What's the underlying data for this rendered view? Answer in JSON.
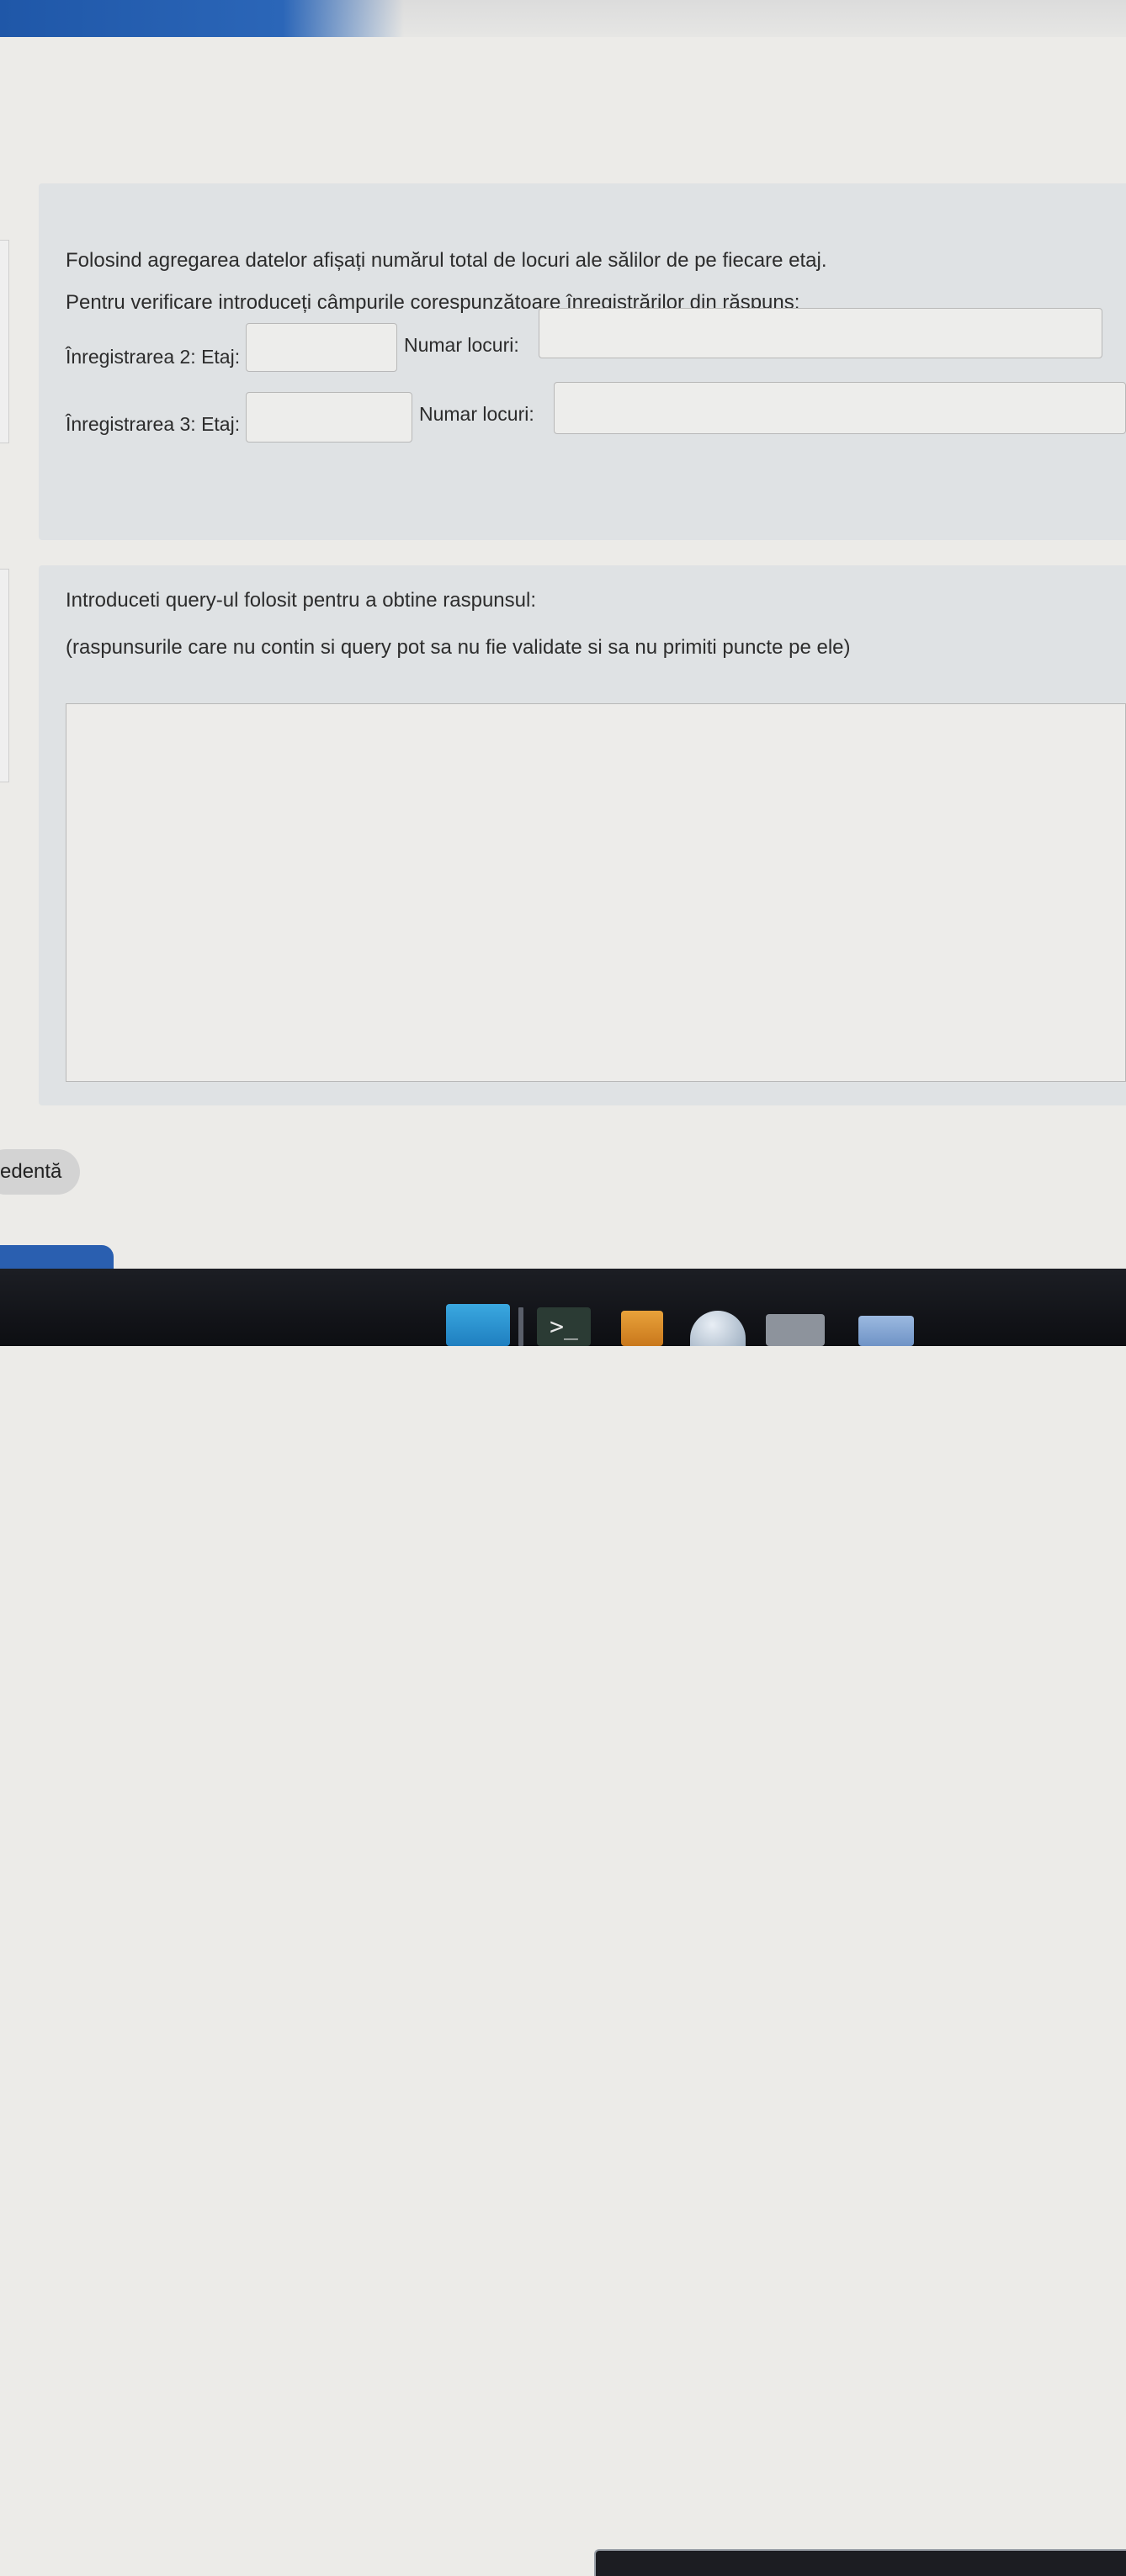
{
  "question1": {
    "prompt": "Folosind agregarea datelor afișați numărul total de locuri ale sălilor de pe fiecare etaj.",
    "instructions": "Pentru verificare introduceți câmpurile corespunzătoare înregistrărilor din răspuns:",
    "rows": [
      {
        "record_label": "Înregistrarea 2: Etaj:",
        "etaj_value": "",
        "seats_label": "Numar locuri:",
        "seats_value": ""
      },
      {
        "record_label": "Înregistrarea 3: Etaj:",
        "etaj_value": "",
        "seats_label": "Numar locuri:",
        "seats_value": ""
      }
    ]
  },
  "question2": {
    "prompt": "Introduceti query-ul folosit pentru a obtine raspunsul:",
    "note": "(raspunsurile care nu contin si query pot sa nu fie validate si sa nu primiti puncte pe ele)",
    "query_value": ""
  },
  "navigation": {
    "previous_label": "edentă"
  },
  "taskbar": {
    "icons": [
      "app-icon",
      "terminal-icon",
      "archive-icon",
      "globe-icon",
      "window-icon"
    ],
    "terminal_glyph": ">_"
  }
}
